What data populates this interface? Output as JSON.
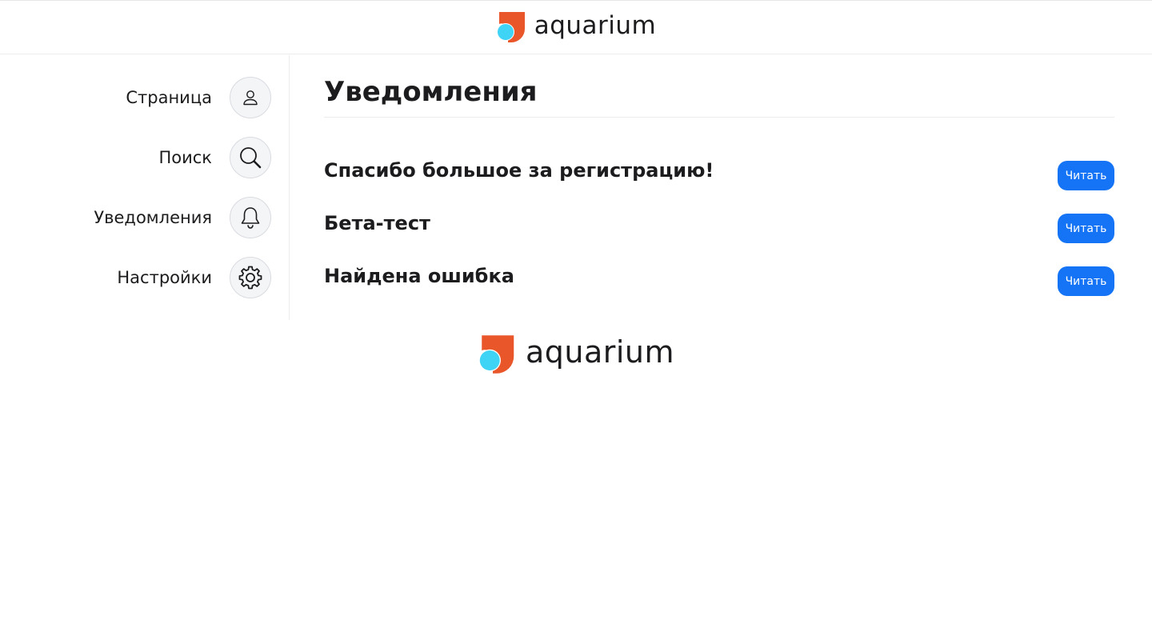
{
  "header": {
    "logo_text": "aquarium"
  },
  "sidebar": {
    "items": [
      {
        "label": "Страница",
        "icon": "user-icon"
      },
      {
        "label": "Поиск",
        "icon": "search-icon"
      },
      {
        "label": "Уведомления",
        "icon": "bell-icon"
      },
      {
        "label": "Настройки",
        "icon": "gear-icon"
      }
    ]
  },
  "main": {
    "title": "Уведомления",
    "notifications": [
      {
        "title": "Спасибо большое за регистрацию!",
        "button_label": "Читать"
      },
      {
        "title": "Бета-тест",
        "button_label": "Читать"
      },
      {
        "title": "Найдена ошибка",
        "button_label": "Читать"
      }
    ]
  },
  "footer": {
    "logo_text": "aquarium"
  },
  "colors": {
    "brand_orange": "#e8562a",
    "brand_cyan": "#3fd3f5",
    "button_blue": "#1574f5"
  }
}
